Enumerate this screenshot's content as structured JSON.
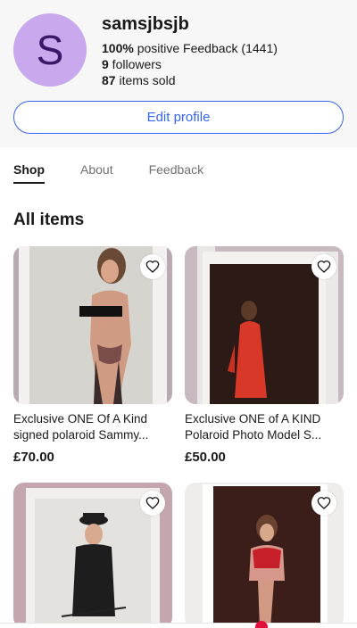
{
  "profile": {
    "avatar_letter": "S",
    "username": "samsjbsjb",
    "feedback_percent": "100%",
    "feedback_text": " positive Feedback (1441)",
    "followers_count": "9",
    "followers_text": " followers",
    "sold_count": "87",
    "sold_text": " items sold",
    "edit_label": "Edit profile"
  },
  "tabs": [
    {
      "label": "Shop",
      "active": true
    },
    {
      "label": "About",
      "active": false
    },
    {
      "label": "Feedback",
      "active": false
    }
  ],
  "section_title": "All items",
  "items": [
    {
      "title": "Exclusive ONE Of A Kind signed polaroid Sammy...",
      "price": "£70.00",
      "icon": "heart-icon"
    },
    {
      "title": "Exclusive ONE of A KIND Polaroid Photo Model S...",
      "price": "£50.00",
      "icon": "heart-icon"
    },
    {
      "title": "",
      "price": "",
      "icon": "heart-icon"
    },
    {
      "title": "",
      "price": "",
      "icon": "heart-icon"
    }
  ],
  "colors": {
    "accent": "#3665f3",
    "avatar_bg": "#c9a8ee",
    "avatar_text": "#3a1768"
  }
}
